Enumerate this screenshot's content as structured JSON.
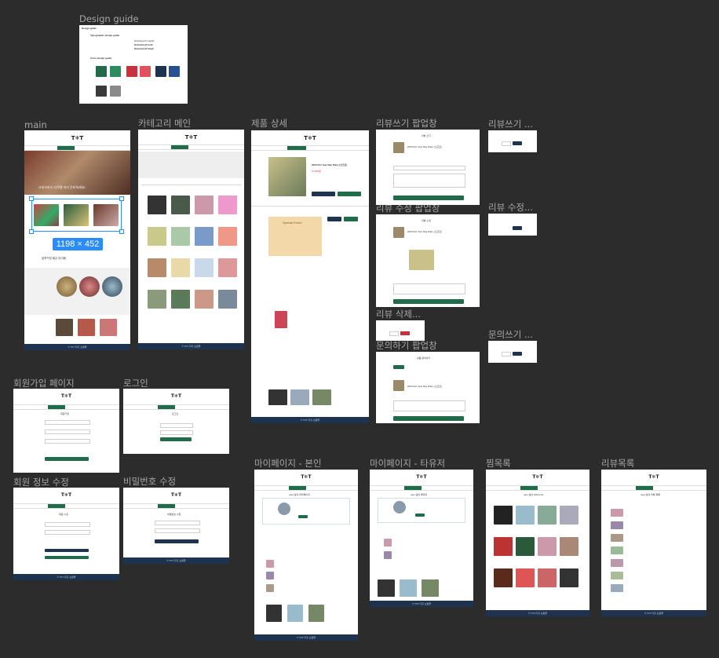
{
  "labels": {
    "design_guide": "Design guide",
    "main": "main",
    "category": "카테고리 메인",
    "product": "제품 상세",
    "review_popup": "리뷰쓰기 팝업창",
    "review_small": "리뷰쓰기 ...",
    "review_edit_popup": "리뷰 수정 팝업창",
    "review_edit_small": "리뷰 수정...",
    "review_delete": "리뷰 삭제...",
    "inquiry_popup": "문의하기 팝업창",
    "inquiry_small": "문의쓰기 ...",
    "signup": "회원가입 페이지",
    "login": "로그인",
    "member_edit": "회원 정보 수정",
    "password_edit": "비밀번호 수정",
    "mypage_self": "마이페이지 - 본인",
    "mypage_other": "마이페이지 - 타유저",
    "wishlist": "찜목록",
    "review_list": "리뷰목록"
  },
  "design_guide": {
    "title": "Design guide",
    "typo_heading": "Typographic design guide",
    "font1": "Helvetica-R regular",
    "font2": "Helvetica-R bold",
    "font3": "Helvetica-R black",
    "color_heading": "Color design guide",
    "colors": [
      "#1f6b4a",
      "#2e8b5f",
      "#c8323c",
      "#e0525c",
      "#1e3350",
      "#27508f",
      "#3a3a3a",
      "#8a8a8a"
    ]
  },
  "main_frame": {
    "logo": "T❄T",
    "banner_text": "크리스마스 다꾸템 미리 준비하세요!",
    "dimension_badge": "1198 × 452",
    "section_text": "달력꾸밈 필수 아이템",
    "footer": "© TXT 다꾸 쇼핑몰"
  },
  "frame_common": {
    "logo": "T❄T",
    "footer": "© TXT 다꾸 쇼핑몰"
  },
  "product": {
    "title": "2023 Dot Year Day Diary (소프트)",
    "price": "11,500원",
    "banner": "Special Event"
  },
  "popups": {
    "review_title": "리뷰 쓰기",
    "review_edit_title": "리뷰 수정",
    "product_name": "2023 Dot Year Day Diary (소프트)",
    "inquiry_title": "상품 문의하기",
    "submit": "등록"
  },
  "forms": {
    "signup_title": "회원가입",
    "login_title": "로그인",
    "member_edit_title": "회원 수정",
    "password_edit_title": "비밀번호 수정"
  },
  "mypage": {
    "self_user": "user 님의 마이페이지",
    "other_user": "user 님의 페이지",
    "wishlist_title": "user 님의 Wish List",
    "review_list_title": "user 님의 리뷰 목록"
  }
}
